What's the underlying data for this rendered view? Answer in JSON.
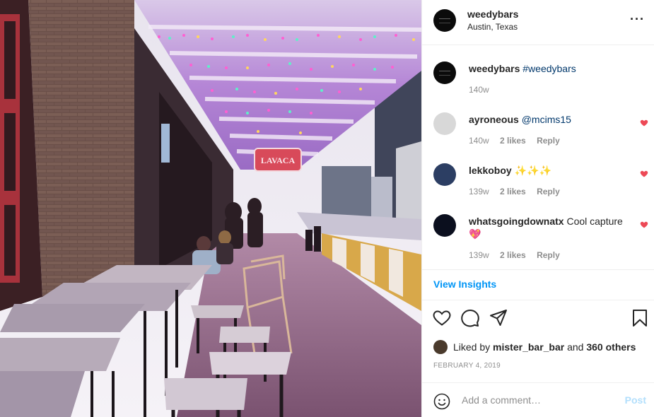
{
  "post": {
    "username": "weedybars",
    "location": "Austin, Texas",
    "more_icon": "more-horizontal-icon",
    "photo_sign_text": "LAVACA"
  },
  "caption": {
    "username": "weedybars",
    "text": "#weedybars",
    "time": "140w"
  },
  "comments": [
    {
      "username": "ayroneous",
      "text": "@mcims15",
      "time": "140w",
      "likes": "2 likes",
      "reply": "Reply"
    },
    {
      "username": "lekkoboy",
      "text": "✨✨✨",
      "time": "139w",
      "likes": "2 likes",
      "reply": "Reply"
    },
    {
      "username": "whatsgoingdownatx",
      "text": "Cool capture",
      "emoji": "💖",
      "time": "139w",
      "likes": "2 likes",
      "reply": "Reply"
    }
  ],
  "view_insights": "View Insights",
  "likes": {
    "prefix": "Liked by",
    "user": "mister_bar_bar",
    "joiner": "and",
    "others": "360 others"
  },
  "date": "FEBRUARY 4, 2019",
  "add_comment": {
    "placeholder": "Add a comment…",
    "post_label": "Post"
  },
  "colors": {
    "accent_blue": "#0095f6",
    "liked_red": "#ed4956",
    "muted_text": "#8e8e8e",
    "post_disabled": "#b2dffc"
  }
}
